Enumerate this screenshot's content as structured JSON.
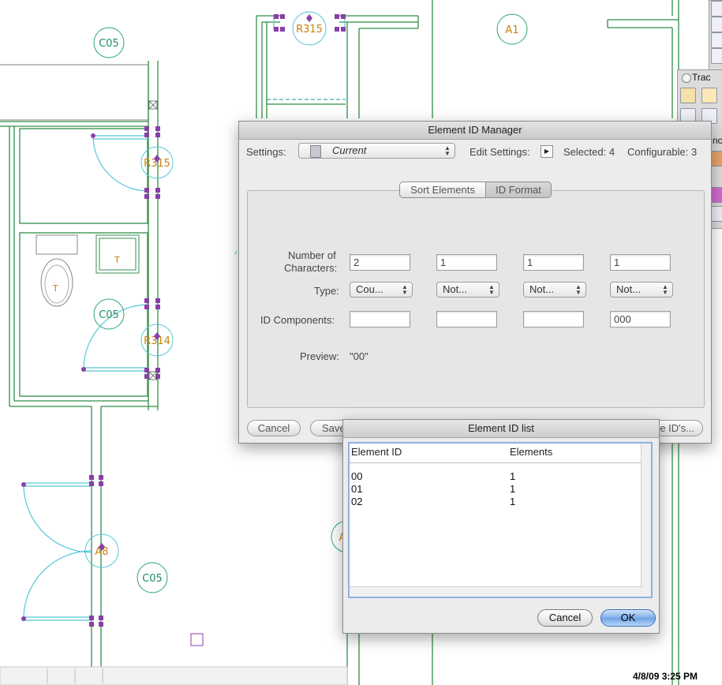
{
  "drawing": {
    "tags": {
      "c05_top": "C05",
      "r315_top": "R315",
      "a1": "A1",
      "r315_mid": "R315",
      "c05_mid": "C05",
      "r314": "R314",
      "a8": "A8",
      "c05_bottom": "C05",
      "a_partial": "A"
    },
    "fixture_labels": {
      "toilet": "T",
      "sink": "T"
    }
  },
  "palette": {
    "title": "Trac",
    "title2": "nc"
  },
  "manager": {
    "title": "Element ID Manager",
    "settings_label": "Settings:",
    "settings_value": "Current",
    "edit_settings_label": "Edit Settings:",
    "selected": "Selected: 4",
    "configurable": "Configurable: 3",
    "tabs": [
      "Sort Elements",
      "ID Format"
    ],
    "row_labels": {
      "num_chars_1": "Number of",
      "num_chars_2": "Characters:",
      "type": "Type:",
      "id_components": "ID Components:",
      "preview": "Preview:"
    },
    "num_chars": [
      "2",
      "1",
      "1",
      "1"
    ],
    "types": [
      "Cou...",
      "Not...",
      "Not...",
      "Not..."
    ],
    "components": [
      "",
      "",
      "",
      "000"
    ],
    "preview_value": "\"00\"",
    "buttons": {
      "cancel": "Cancel",
      "save": "Save",
      "assign": "e ID's..."
    }
  },
  "idlist": {
    "title": "Element ID list",
    "columns": [
      "Element ID",
      "Elements"
    ],
    "rows": [
      {
        "id": "00",
        "count": "1"
      },
      {
        "id": "01",
        "count": "1"
      },
      {
        "id": "02",
        "count": "1"
      }
    ],
    "buttons": {
      "cancel": "Cancel",
      "ok": "OK"
    }
  },
  "clock": "4/8/09 3:25 PM",
  "colors": {
    "wall": "#2f8f45",
    "door": "#55c8d8",
    "tag": "#2aa57a",
    "grip": "#8a3fa8",
    "ok_button": "#6ea2e3"
  }
}
